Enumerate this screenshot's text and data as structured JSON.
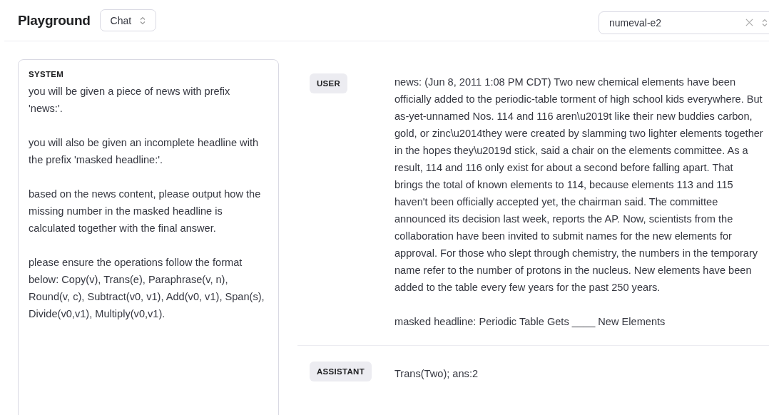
{
  "header": {
    "title": "Playground",
    "mode_select": {
      "value": "Chat"
    },
    "model_select": {
      "value": "numeval-e2"
    }
  },
  "system": {
    "label": "SYSTEM",
    "paragraphs": [
      "you will be given a piece of news with prefix 'news:'.",
      "you will also be given an incomplete headline with the prefix 'masked headline:'.",
      "based on the news content, please output how the missing number in the masked headline is calculated together with the final answer.",
      "please ensure the operations follow the format below: Copy(v), Trans(e), Paraphrase(v, n), Round(v, c), Subtract(v0, v1), Add(v0, v1), Span(s), Divide(v0,v1), Multiply(v0,v1)."
    ]
  },
  "messages": [
    {
      "role": "USER",
      "paragraphs": [
        "news: (Jun 8, 2011  1:08 PM CDT) Two new chemical elements have been officially added to the periodic-table torment of high school kids everywhere. But as-yet-unnamed Nos. 114 and 116 aren\\u2019t like their new buddies carbon, gold, or zinc\\u2014they were created by slamming two lighter elements together in the hopes they\\u2019d stick, said a chair on the elements committee. As a result, 114 and 116 only exist for about a second before falling apart. That brings the total of known elements to 114, because elements 113 and 115 haven't been officially accepted yet, the chairman said. The committee announced its decision last week, reports the AP. Now, scientists from the collaboration have been invited to submit names for the new elements for approval. For those who slept through chemistry, the numbers in the temporary name refer to the number of protons in the nucleus. New elements have been added to the table every few years for the past 250 years.",
        "masked headline: Periodic Table Gets ____ New Elements"
      ]
    },
    {
      "role": "ASSISTANT",
      "paragraphs": [
        "Trans(Two); ans:2"
      ]
    }
  ]
}
